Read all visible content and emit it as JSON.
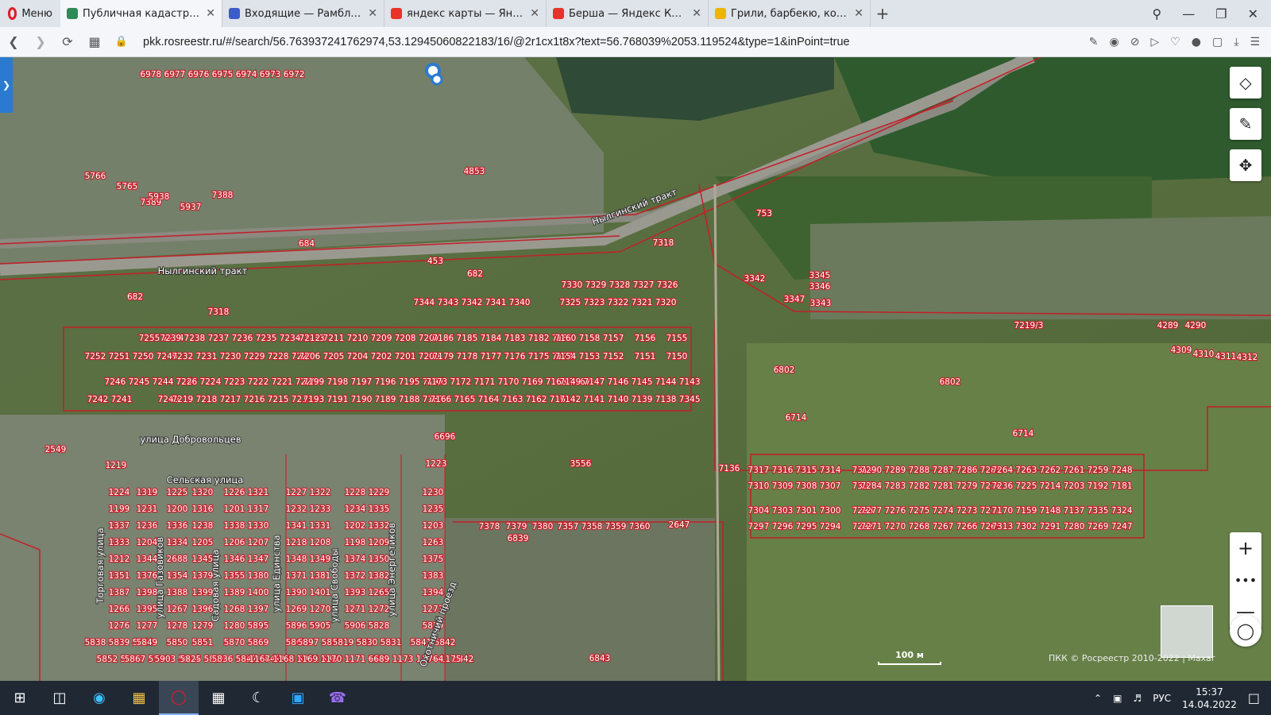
{
  "browser": {
    "menu_label": "Меню",
    "tabs": [
      {
        "title": "Публичная кадастровая к",
        "active": true,
        "color": "#2e8b57"
      },
      {
        "title": "Входящие — Рамблер/по",
        "active": false,
        "color": "#3b5ccc"
      },
      {
        "title": "яндекс карты — Яндекс: н",
        "active": false,
        "color": "#e8322a"
      },
      {
        "title": "Берша — Яндекс Карты",
        "active": false,
        "color": "#e8322a"
      },
      {
        "title": "Грили, барбекю, коптиль",
        "active": false,
        "color": "#f0b400"
      }
    ],
    "url": "pkk.rosreestr.ru/#/search/56.763937241762974,53.12945060822183/16/@2r1cx1t8x?text=56.768039%2053.119524&type=1&inPoint=true"
  },
  "map": {
    "road_labels": [
      "Нылгинский тракт",
      "Нылгинский тракт",
      "улица Добровольцев",
      "Сельская улица",
      "Торговая улица",
      "улица Газовиков",
      "Садовая улица",
      "улица Единства",
      "улица Свободы",
      "улица Энергетиков",
      "Охотничий проезд"
    ],
    "parcel_labels": [
      "7388",
      "7389",
      "4853",
      "684",
      "453",
      "682",
      "682",
      "7318",
      "7318",
      "7330 7329 7328 7327 7326",
      "7325 7323 7322 7321 7320",
      "7344 7343 7342 7341 7340",
      "753",
      "3345",
      "3346",
      "3347",
      "3343",
      "3342",
      "6802",
      "6802",
      "6714",
      "6714",
      "7219/3",
      "4289",
      "4290",
      "4309",
      "4310",
      "4311",
      "4312",
      "3556",
      "6696",
      "2549",
      "1219",
      "1223",
      "7136",
      "7378",
      "7379",
      "7380",
      "7357 7358 7359 7360",
      "2647",
      "6839",
      "6842",
      "6843",
      "7311",
      "7305",
      "7298",
      "7292",
      "7255 7254",
      "7239 7238 7237 7236 7235 7234 7233",
      "7212 7211 7210 7209 7208 7207",
      "7186 7185 7184 7183 7182 7180",
      "7160 7158 7157",
      "7156",
      "7155",
      "7252 7251 7250 7249",
      "7232 7231 7230 7229 7228 7227",
      "7206 7205 7204 7202 7201 7200",
      "7179 7178 7177 7176 7175 7174",
      "7154 7153 7152",
      "7151",
      "7150",
      "7246 7245 7244 7243",
      "7226 7224 7223 7222 7221 7220",
      "7199 7198 7197 7196 7195 7194",
      "7173 7172 7171 7170 7169 7168 7167",
      "7149 7147 7146 7145 7144 7143",
      "7242 7241",
      "7240",
      "7219 7218 7217 7216 7215 7213",
      "7193 7191 7190 7189 7188 7187",
      "7166 7165 7164 7163 7162 7161",
      "7142 7141 7140 7139 7138 7345",
      "7317 7316 7315 7314",
      "7290 7289 7288 7287 7286 7285",
      "7264 7263 7262 7261 7259 7248",
      "7310 7309 7308 7307",
      "7284 7283 7282 7281 7279 7278",
      "7236 7225 7214 7203 7192 7181",
      "7304 7303 7301 7300",
      "7277 7276 7275 7274 7273 7272",
      "7170 7159 7148 7137 7335 7324",
      "7297 7296 7295 7294",
      "7271 7270 7268 7267 7266 7265",
      "7313 7302 7291 7280 7269 7247",
      "1224",
      "1319",
      "1225",
      "1320",
      "1226",
      "1321",
      "1227",
      "1322",
      "1228",
      "1229",
      "1230",
      "1199",
      "1231",
      "1200",
      "1316",
      "1201",
      "1317",
      "1232",
      "1233",
      "1234",
      "1335",
      "1235",
      "1337",
      "1236",
      "1336",
      "1238",
      "1338",
      "1330",
      "1341",
      "1331",
      "1202",
      "1332",
      "1203",
      "1333",
      "1204",
      "1334",
      "1205",
      "1206",
      "1207",
      "1218",
      "1208",
      "1198",
      "1209",
      "1263",
      "1212",
      "1344",
      "2688",
      "1345",
      "1346",
      "1347",
      "1348",
      "1349",
      "1374",
      "1350",
      "1375",
      "1351",
      "1376",
      "1354",
      "1379",
      "1355",
      "1380",
      "1371",
      "1381",
      "1372",
      "1382",
      "1383",
      "1387",
      "1398",
      "1388",
      "1399",
      "1389",
      "1400",
      "1390",
      "1401",
      "1393",
      "1265",
      "1394",
      "1266",
      "1395",
      "1267",
      "1396",
      "1268",
      "1397",
      "1269",
      "1270",
      "1271",
      "1272",
      "1273",
      "1276",
      "1277",
      "1278",
      "1279",
      "1280",
      "5895",
      "5896",
      "5905",
      "5906",
      "5828",
      "5829",
      "5838 5839 5840",
      "5849",
      "5850",
      "5851",
      "5870",
      "5869",
      "5868",
      "5897 5898",
      "5819 5820",
      "5830 5831",
      "5841 5842",
      "5852 5853",
      "5867 5866",
      "5903 5904",
      "5825 5826",
      "5836 5837",
      "5847 5848",
      "5858 5859",
      "5861 5860",
      "1167 1168 1169 1170 1171 1172 1173 1174 1175",
      "6689",
      "5764",
      "5766",
      "5765",
      "5938",
      "5937",
      "6978 6977 6976 6975 6974 6973 6972"
    ],
    "scale_label": "100 м",
    "copyright": "ПКК © Росреестр 2010-2022 | Махаr"
  },
  "taskbar": {
    "language": "РУС",
    "time": "15:37",
    "date": "14.04.2022"
  }
}
